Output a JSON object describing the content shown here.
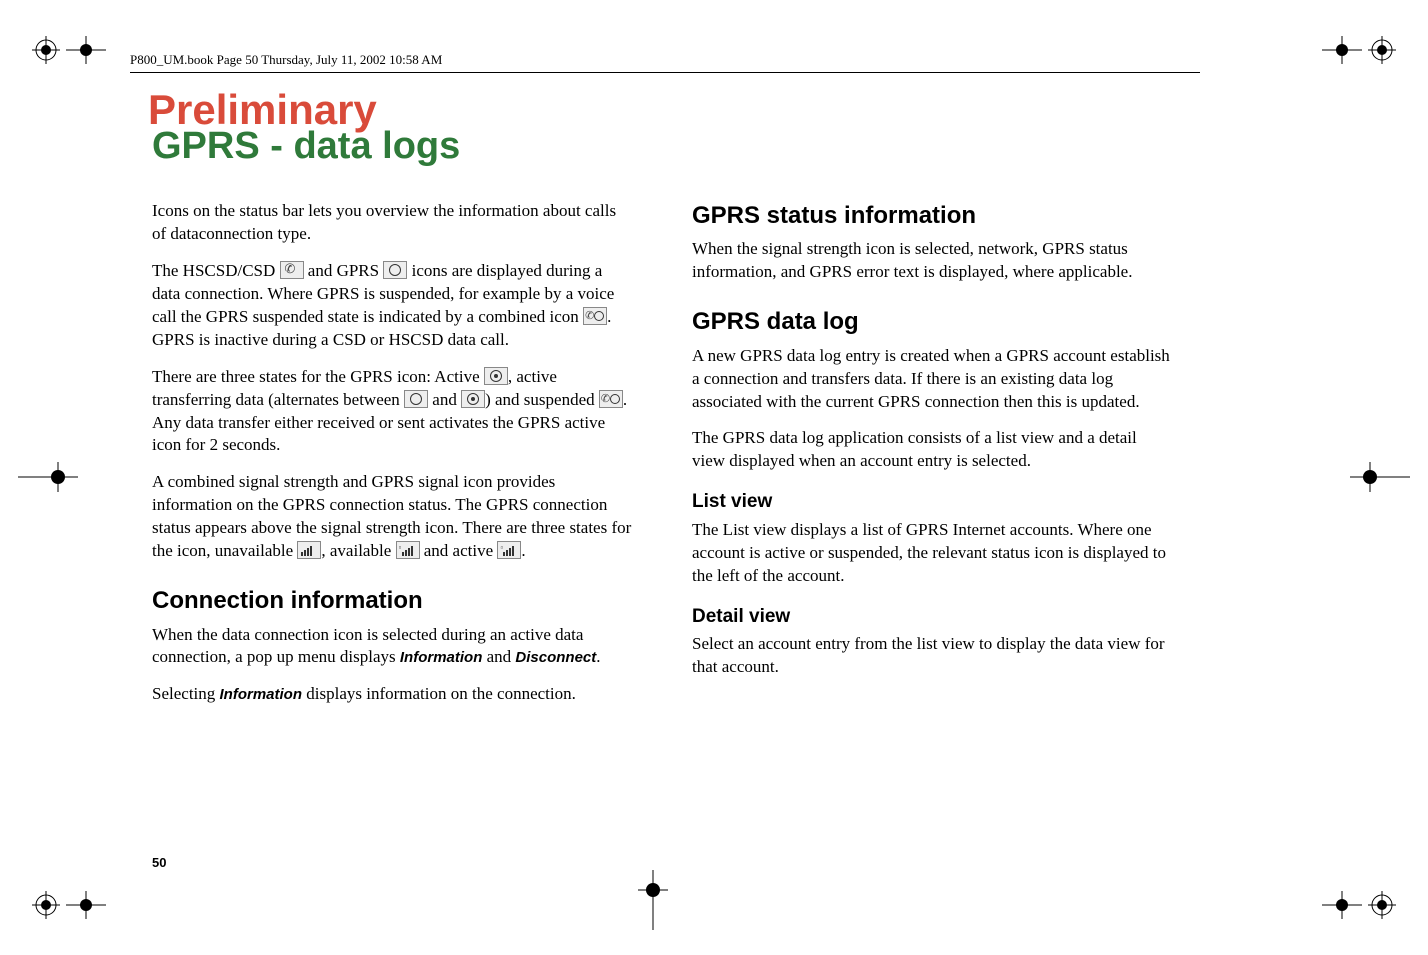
{
  "header": "P800_UM.book  Page 50  Thursday, July 11, 2002  10:58 AM",
  "watermark": "Preliminary",
  "title": "GPRS - data logs",
  "page_number": "50",
  "left": {
    "p1": "Icons on the status bar lets you overview the information about calls of dataconnection type.",
    "p2a": "The HSCSD/CSD ",
    "p2b": " and GPRS ",
    "p2c": " icons are displayed during a data connection. Where GPRS is suspended, for example by a voice call the GPRS suspended state is indicated by a combined icon ",
    "p2d": ". GPRS is inactive during a CSD or HSCSD data call.",
    "p3a": "There are three states for the GPRS icon: Active ",
    "p3b": ", active transferring data (alternates between ",
    "p3c": " and ",
    "p3d": ") and suspended ",
    "p3e": ". Any data transfer either received or sent activates the GPRS active icon for 2 seconds.",
    "p4a": "A combined signal strength and GPRS signal icon provides information on the GPRS connection status. The GPRS connection status appears above the signal strength icon. There are three states for the icon, unavailable ",
    "p4b": ", available ",
    "p4c": " and active ",
    "p4d": ".",
    "h2_conn": "Connection information",
    "p5a": "When the data connection icon is selected during an active data connection, a pop up menu displays ",
    "p5_info": "Information",
    "p5b": " and ",
    "p5_disc": "Disconnect",
    "p5c": ".",
    "p6a": "Selecting ",
    "p6_info": "Information",
    "p6b": " displays information on the connection."
  },
  "right": {
    "h2_status": "GPRS status information",
    "p1": "When the signal strength icon is selected, network, GPRS status information, and GPRS error text is displayed, where applicable.",
    "h2_log": "GPRS data log",
    "p2": "A new GPRS data log entry is created when a GPRS account establish a connection and transfers data. If there is an existing data log associated with the current GPRS connection then this is updated.",
    "p3": "The GPRS data log application consists of a list view and a detail view displayed when an account entry is selected.",
    "h3_list": "List view",
    "p4": "The List view displays a list of GPRS Internet accounts. Where one account is active or suspended, the relevant status icon is displayed to the left of the account.",
    "h3_detail": "Detail view",
    "p5": "Select an account entry from the list view to display the data view for that account."
  }
}
